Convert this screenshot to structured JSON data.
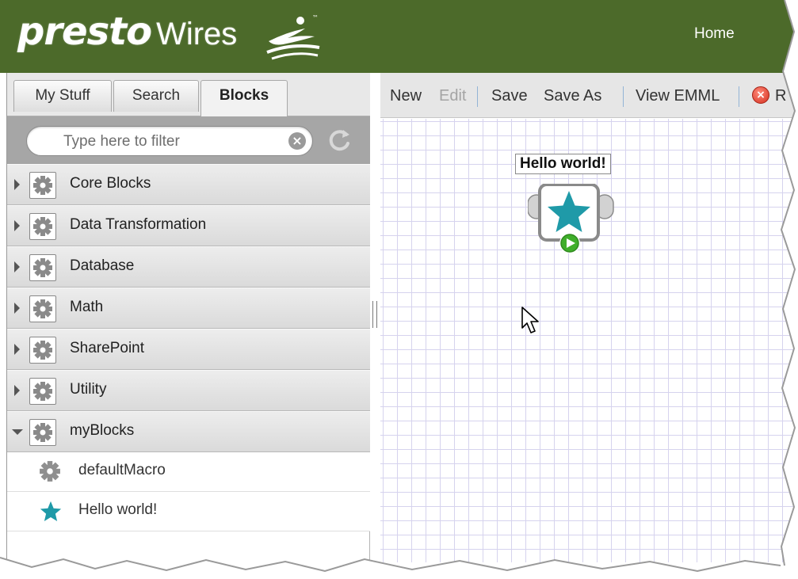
{
  "header": {
    "brand_main": "presto",
    "brand_sub": "Wires",
    "trademark": "™",
    "nav_home": "Home"
  },
  "tabs": [
    {
      "label": "My Stuff",
      "active": false
    },
    {
      "label": "Search",
      "active": false
    },
    {
      "label": "Blocks",
      "active": true
    }
  ],
  "filter": {
    "placeholder": "Type here to filter",
    "clear_icon": "clear-circle-icon",
    "refresh_icon": "refresh-icon"
  },
  "categories": [
    {
      "label": "Core Blocks",
      "expanded": false
    },
    {
      "label": "Data Transformation",
      "expanded": false
    },
    {
      "label": "Database",
      "expanded": false
    },
    {
      "label": "Math",
      "expanded": false
    },
    {
      "label": "SharePoint",
      "expanded": false
    },
    {
      "label": "Utility",
      "expanded": false
    },
    {
      "label": "myBlocks",
      "expanded": true
    }
  ],
  "my_blocks": [
    {
      "label": "defaultMacro",
      "icon": "gear-icon"
    },
    {
      "label": "Hello world!",
      "icon": "star-icon"
    }
  ],
  "toolbar": {
    "new": "New",
    "edit": "Edit",
    "save": "Save",
    "save_as": "Save As",
    "view_emml": "View EMML",
    "remove_partial": "R"
  },
  "canvas": {
    "node_label": "Hello world!",
    "node_icon": "star-icon",
    "run_icon": "play-icon"
  },
  "colors": {
    "header_bg": "#4c6a2a",
    "star": "#1f9aa8",
    "grid": "#d6d3ee",
    "run_badge": "#3fae2a"
  }
}
